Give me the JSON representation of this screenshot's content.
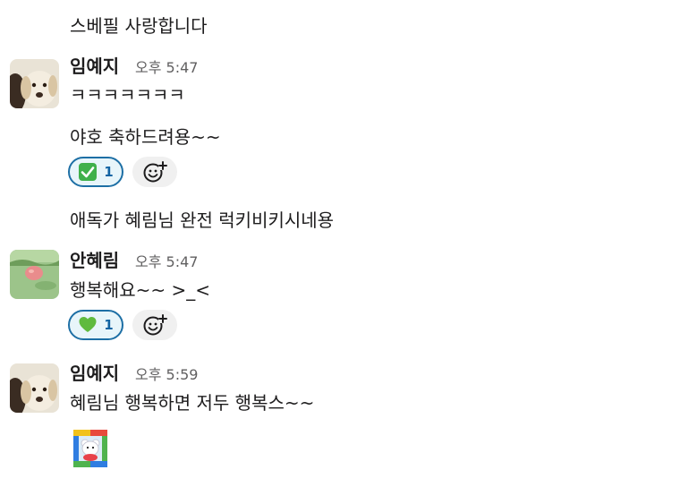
{
  "messages": {
    "m0": {
      "text": "스베필 사랑합니다"
    },
    "g1": {
      "name": "임예지",
      "time": "오후 5:47",
      "lines": [
        "ㅋㅋㅋㅋㅋㅋㅋ",
        "야호 축하드려용~~"
      ],
      "reaction": {
        "icon": "check-mark-emoji",
        "count": "1"
      }
    },
    "m3": {
      "text": "애독가 혜림님 완전 럭키비키시네용"
    },
    "g2": {
      "name": "안혜림",
      "time": "오후 5:47",
      "lines": [
        "행복해요~~ >_<"
      ],
      "reaction": {
        "icon": "green-heart-emoji",
        "count": "1"
      }
    },
    "g3": {
      "name": "임예지",
      "time": "오후 5:59",
      "lines": [
        "혜림님 행복하면 저두 행복스~~"
      ]
    }
  },
  "colors": {
    "text": "#1d1c1d",
    "timestamp": "#616061",
    "reaction_border": "#1d6fa5",
    "reaction_bg": "#e8f5fa",
    "reaction_count": "#1264a3",
    "add_reaction_bg": "#f0f0f0"
  },
  "icons": {
    "add_reaction": "add-reaction-icon",
    "custom_emoji": "hamster-sticker-emoji"
  }
}
